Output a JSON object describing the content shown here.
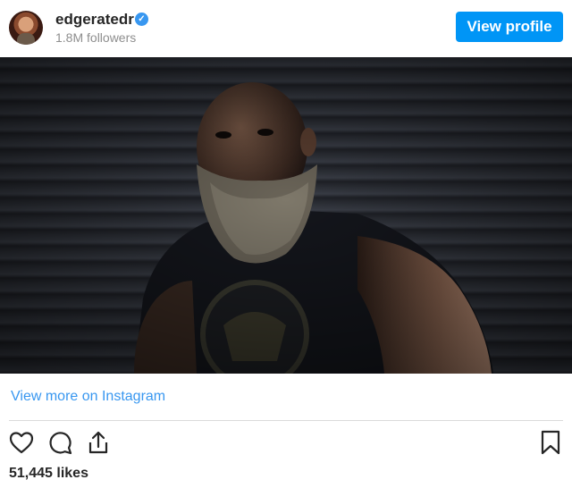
{
  "header": {
    "username": "edgeratedr",
    "followers": "1.8M followers",
    "view_profile_label": "View profile"
  },
  "footer": {
    "view_more_label": "View more on Instagram",
    "likes": "51,445 likes"
  },
  "icons": {
    "verified": "verified-badge-icon",
    "like": "heart-icon",
    "comment": "comment-icon",
    "share": "share-icon",
    "save": "bookmark-icon"
  },
  "colors": {
    "accent": "#0095f6",
    "link": "#3897f0",
    "text": "#262626",
    "muted": "#8e8e8e"
  }
}
